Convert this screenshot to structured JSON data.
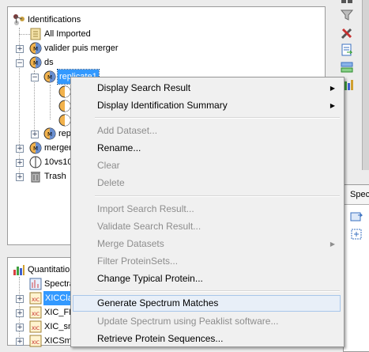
{
  "tree": {
    "root": "Identifications",
    "items": [
      {
        "label": "All Imported"
      },
      {
        "label": "valider puis merger"
      },
      {
        "label": "ds"
      },
      {
        "label": "replicate1"
      },
      {
        "label": "rep"
      },
      {
        "label": "merger"
      },
      {
        "label": "10vs10"
      },
      {
        "label": "Trash"
      }
    ]
  },
  "quant_tree": {
    "root": "Quantitation",
    "items": [
      {
        "label": "Spectra"
      },
      {
        "label": "XICClass"
      },
      {
        "label": "XIC_FR"
      },
      {
        "label": "XIC_sm"
      },
      {
        "label": "XICSm"
      }
    ]
  },
  "spec_tab": {
    "label": "Spec"
  },
  "context_menu": {
    "items": [
      {
        "label": "Display Search Result",
        "enabled": true,
        "submenu": true
      },
      {
        "label": "Display Identification Summary",
        "enabled": true,
        "submenu": true
      },
      {
        "label": "Add Dataset...",
        "enabled": false
      },
      {
        "label": "Rename...",
        "enabled": true
      },
      {
        "label": "Clear",
        "enabled": false
      },
      {
        "label": "Delete",
        "enabled": false
      },
      {
        "label": "Import Search Result...",
        "enabled": false
      },
      {
        "label": "Validate Search Result...",
        "enabled": false
      },
      {
        "label": "Merge Datasets",
        "enabled": false,
        "submenu": true
      },
      {
        "label": "Filter ProteinSets...",
        "enabled": false
      },
      {
        "label": "Change Typical Protein...",
        "enabled": true
      },
      {
        "label": "Generate Spectrum Matches",
        "enabled": true,
        "highlighted": true
      },
      {
        "label": "Update Spectrum using Peaklist software...",
        "enabled": false
      },
      {
        "label": "Retrieve Protein Sequences...",
        "enabled": true
      }
    ]
  },
  "icons": {
    "toolbar": [
      "grid-icon",
      "filter-icon",
      "tools-icon",
      "export-icon",
      "split-icon",
      "bar-chart-icon"
    ]
  }
}
